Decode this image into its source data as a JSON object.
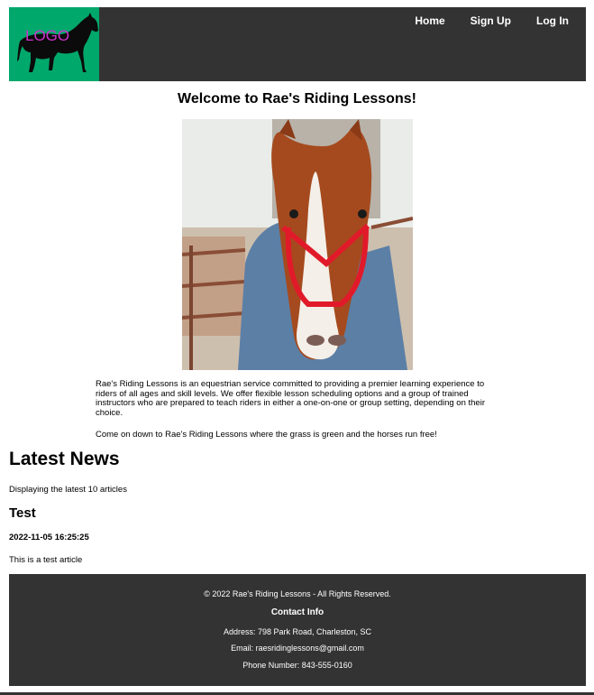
{
  "header": {
    "logo_text": "LOGO",
    "nav": [
      "Home",
      "Sign Up",
      "Log In"
    ]
  },
  "main": {
    "title": "Welcome to Rae's Riding Lessons!",
    "intro_p1": "Rae's Riding Lessons is an equestrian service committed to providing a premier learning experience to riders of all ages and skill levels. We offer flexible lesson scheduling options and a group of trained instructors who are prepared to teach riders in either a one-on-one or group setting, depending on their choice.",
    "intro_p2": "Come on down to Rae's Riding Lessons where the grass is green and the horses run free!"
  },
  "news": {
    "heading": "Latest News",
    "subtitle": "Displaying the latest 10 articles",
    "articles": [
      {
        "title": "Test",
        "date": "2022-11-05 16:25:25",
        "body": "This is a test article"
      }
    ]
  },
  "footer": {
    "copyright": "© 2022 Rae's Riding Lessons - All Rights Reserved.",
    "contact_heading": "Contact Info",
    "address": "Address:  798 Park Road, Charleston, SC",
    "email": "Email:  raesridinglessons@gmail.com",
    "phone": "Phone Number:  843-555-0160"
  },
  "colors": {
    "header_bg": "#333333",
    "logo_bg": "#00a86b",
    "logo_text": "#cc33cc"
  }
}
